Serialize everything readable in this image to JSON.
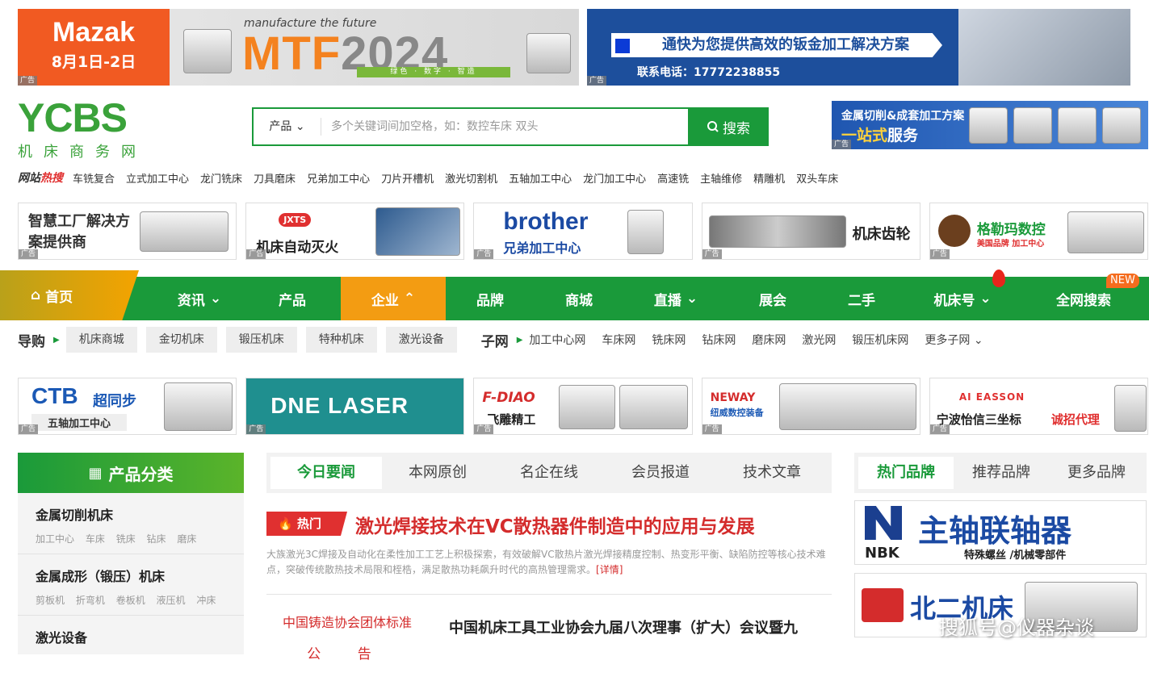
{
  "ad_label": "广告",
  "top_banners": {
    "mazak": {
      "brand": "Mazak",
      "date": "8月1日-2日"
    },
    "mtf": {
      "tagline": "manufacture the future",
      "title_main": "MTF",
      "title_year": "2024",
      "bar": "绿色 · 数字 · 智造"
    },
    "trumpf": {
      "title": "通快为您提供高效的钣金加工解决方案",
      "phone": "联系电话：17772238855"
    }
  },
  "logo": {
    "letters": "YCBS",
    "cn": "机床商务网"
  },
  "search": {
    "category": "产品",
    "placeholder": "多个关键词间加空格，如：数控车床 双头",
    "button": "搜索"
  },
  "right_ad": {
    "line1": "金属切削&成套加工方案",
    "line2_a": "一站式",
    "line2_b": "服务"
  },
  "hot_search": {
    "label_a": "网站",
    "label_b": "热搜",
    "items": [
      "车铣复合",
      "立式加工中心",
      "龙门铣床",
      "刀具磨床",
      "兄弟加工中心",
      "刀片开槽机",
      "激光切割机",
      "五轴加工中心",
      "龙门加工中心",
      "高速铣",
      "主轴维修",
      "精雕机",
      "双头车床"
    ]
  },
  "ads_row1": [
    {
      "text": "智慧工厂解决方案提供商"
    },
    {
      "text": "机床自动灭火",
      "brand": "JXTS"
    },
    {
      "text": "兄弟加工中心",
      "brand": "brother"
    },
    {
      "text": "机床齿轮"
    },
    {
      "text": "格勒玛数控",
      "sub": "美国品牌 加工中心"
    }
  ],
  "nav": {
    "home": "首页",
    "items": [
      "资讯",
      "产品",
      "企业",
      "品牌",
      "商城",
      "直播",
      "展会",
      "二手",
      "机床号",
      "全网搜索"
    ],
    "new_badge": "NEW"
  },
  "subnav": {
    "guide_label": "导购",
    "pills": [
      "机床商城",
      "金切机床",
      "锻压机床",
      "特种机床",
      "激光设备"
    ],
    "sub_label": "子网",
    "links": [
      "加工中心网",
      "车床网",
      "铣床网",
      "钻床网",
      "磨床网",
      "激光网",
      "锻压机床网",
      "更多子网"
    ]
  },
  "ads_row2": [
    {
      "brand": "CTB",
      "text": "超同步",
      "sub": "五轴加工中心"
    },
    {
      "brand": "DNE LASER"
    },
    {
      "brand": "F-DIAO",
      "text": "飞雕精工"
    },
    {
      "brand": "NEWAY",
      "text": "纽威数控装备"
    },
    {
      "brand": "AI EASSON",
      "text": "宁波怡信三坐标",
      "sub": "诚招代理"
    }
  ],
  "categories": {
    "title": "产品分类",
    "items": [
      {
        "title": "金属切削机床",
        "subs": [
          "加工中心",
          "车床",
          "铣床",
          "钻床",
          "磨床"
        ]
      },
      {
        "title": "金属成形（锻压）机床",
        "subs": [
          "剪板机",
          "折弯机",
          "卷板机",
          "液压机",
          "冲床"
        ]
      },
      {
        "title": "激光设备",
        "subs": []
      }
    ]
  },
  "news": {
    "tabs": [
      "今日要闻",
      "本网原创",
      "名企在线",
      "会员报道",
      "技术文章"
    ],
    "hot_label": "热门",
    "headline": "激光焊接技术在VC散热器件制造中的应用与发展",
    "summary": "大族激光3C焊接及自动化在柔性加工工艺上积极探索，有效破解VC散热片激光焊接精度控制、热变形平衡、缺陷防控等核心技术难点，突破传统散热技术局限和桎梏，满足散热功耗飙升时代的高热管理需求。",
    "more": "[详情]",
    "notice_line1": "中国铸造协会团体标准",
    "notice_line2": "公 告",
    "second_headline": "中国机床工具工业协会九届八次理事（扩大）会议暨九"
  },
  "brands": {
    "tabs": [
      "热门品牌",
      "推荐品牌",
      "更多品牌"
    ],
    "brand1": {
      "logo": "NBK",
      "title": "主轴联轴器",
      "sub": "特殊螺丝 /机械零部件"
    },
    "brand2": {
      "title": "北二机床"
    }
  },
  "watermark": "搜狐号@仪器杂谈"
}
